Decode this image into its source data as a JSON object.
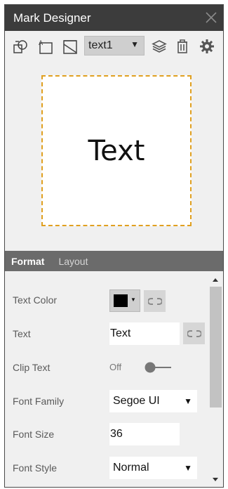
{
  "window": {
    "title": "Mark Designer"
  },
  "toolbar": {
    "icons": [
      "shapes-icon",
      "text-element-icon",
      "image-element-icon",
      "layers-icon",
      "delete-icon",
      "settings-icon"
    ],
    "element_select": {
      "value": "text1"
    }
  },
  "preview": {
    "text": "Text",
    "border_color": "#e0a020"
  },
  "tabs": [
    {
      "label": "Format",
      "active": true
    },
    {
      "label": "Layout",
      "active": false
    }
  ],
  "properties": {
    "text_color": {
      "label": "Text Color",
      "value": "#000000"
    },
    "text": {
      "label": "Text",
      "value": "Text"
    },
    "clip_text": {
      "label": "Clip Text",
      "state": "Off"
    },
    "font_family": {
      "label": "Font Family",
      "value": "Segoe UI"
    },
    "font_size": {
      "label": "Font Size",
      "value": "36"
    },
    "font_style": {
      "label": "Font Style",
      "value": "Normal"
    }
  },
  "colors": {
    "titlebar": "#3c3c3c",
    "tabs_bg": "#6b6b6b",
    "panel_bg": "#f0f0f0",
    "accent_border": "#e0a020"
  }
}
